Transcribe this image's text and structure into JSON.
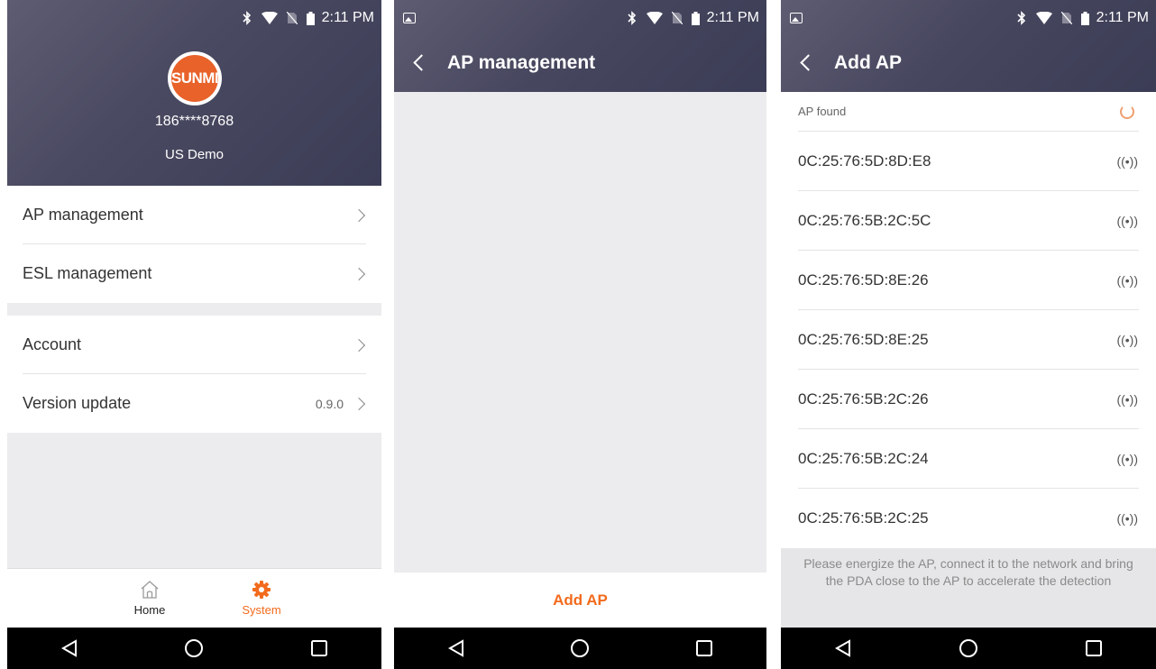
{
  "status_bar": {
    "time": "2:11 PM"
  },
  "screen1": {
    "logo_text": "SUNMI",
    "phone": "186****8768",
    "store": "US Demo",
    "menu_group1": [
      {
        "label": "AP management"
      },
      {
        "label": "ESL management"
      }
    ],
    "menu_group2": [
      {
        "label": "Account"
      },
      {
        "label": "Version update",
        "value": "0.9.0"
      }
    ],
    "tabs": [
      {
        "label": "Home",
        "icon": "home-icon"
      },
      {
        "label": "System",
        "icon": "gear-icon",
        "active": true
      }
    ]
  },
  "screen2": {
    "title": "AP management",
    "add_button": "Add AP"
  },
  "screen3": {
    "title": "Add AP",
    "found_label": "AP found",
    "aps": [
      {
        "mac": "0C:25:76:5D:8D:E8",
        "signal": "((•))"
      },
      {
        "mac": "0C:25:76:5B:2C:5C",
        "signal": "((•))"
      },
      {
        "mac": "0C:25:76:5D:8E:26",
        "signal": "((•))"
      },
      {
        "mac": "0C:25:76:5D:8E:25",
        "signal": "((•))"
      },
      {
        "mac": "0C:25:76:5B:2C:26",
        "signal": "((•))"
      },
      {
        "mac": "0C:25:76:5B:2C:24",
        "signal": "((•))"
      },
      {
        "mac": "0C:25:76:5B:2C:25",
        "signal": "((•))"
      }
    ],
    "tip": "Please energize the AP, connect it to the network and bring the PDA close to the AP to accelerate the detection"
  },
  "colors": {
    "accent": "#f26b1d",
    "header_dark": "#3b3c55",
    "background": "#ececee"
  }
}
